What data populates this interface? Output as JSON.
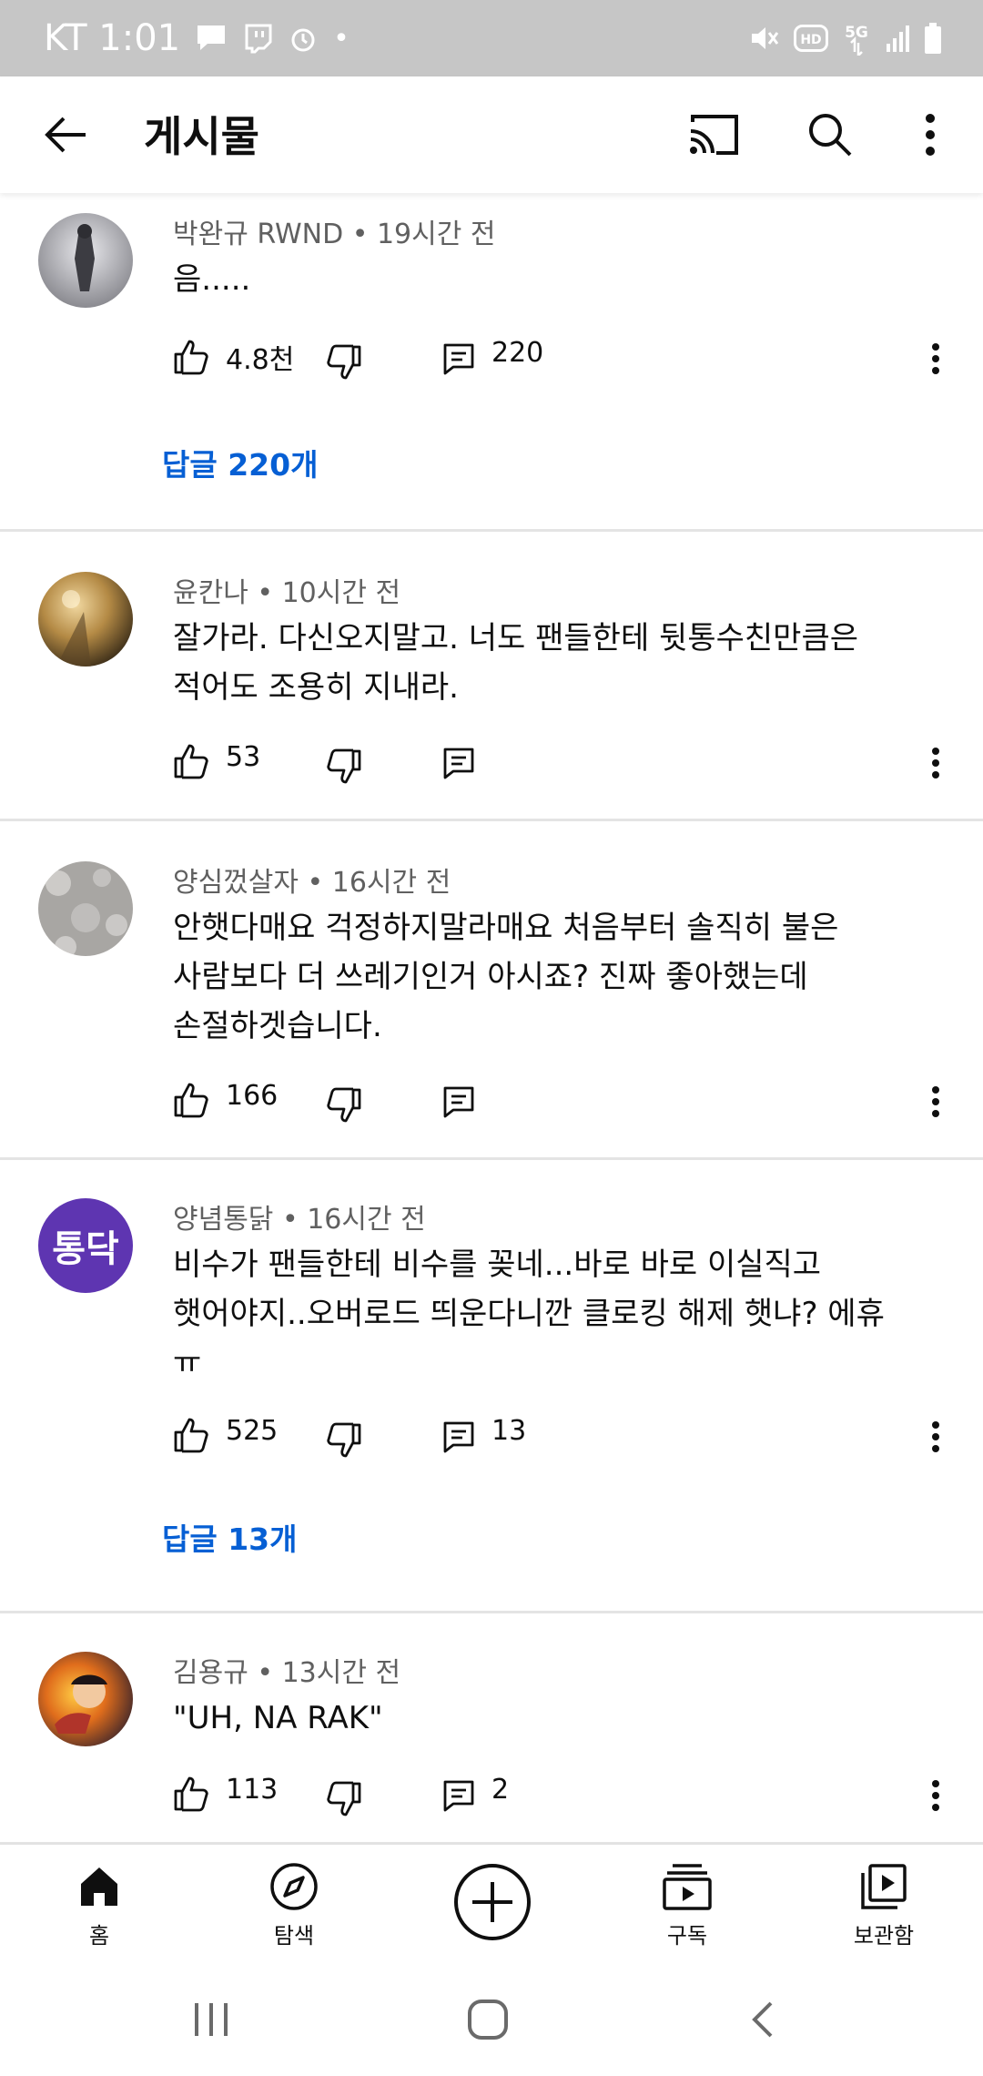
{
  "status_bar": {
    "carrier_time": "KT 1:01",
    "dot": "•",
    "icons": [
      "message-icon",
      "twitch-icon",
      "alarm-icon",
      "mute-icon",
      "hd-icon",
      "5g-icon",
      "signal-icon",
      "battery-icon"
    ]
  },
  "app_bar": {
    "title": "게시물",
    "icons": [
      "back-arrow-icon",
      "cast-icon",
      "search-icon",
      "more-vert-icon"
    ]
  },
  "comments": [
    {
      "author": "박완규 RWND",
      "time": "19시간 전",
      "text_lines": [
        "음....."
      ],
      "likes": "4.8천",
      "replies": "220",
      "replies_link": "답글 220개",
      "avatar": {
        "type": "photo",
        "colors": [
          "#d8d8dc",
          "#55555a"
        ]
      }
    },
    {
      "author": "윤칸나",
      "time": "10시간 전",
      "text_lines": [
        "잘가라. 다신오지말고. 너도 팬들한테 뒷통수친만큼은",
        "적어도 조용히 지내라."
      ],
      "likes": "53",
      "replies": "",
      "replies_link": "",
      "avatar": {
        "type": "photo",
        "colors": [
          "#c9a35d",
          "#4a3a20"
        ]
      }
    },
    {
      "author": "양심껐살자",
      "time": "16시간 전",
      "text_lines": [
        "안햇다매요 걱정하지말라매요 처음부터 솔직히 불은",
        "사람보다 더 쓰레기인거 아시죠? 진짜 좋아했는데",
        "손절하겟습니다."
      ],
      "likes": "166",
      "replies": "",
      "replies_link": "",
      "avatar": {
        "type": "photo",
        "colors": [
          "#b8b6b3",
          "#8e8c89"
        ]
      }
    },
    {
      "author": "양념통닭",
      "time": "16시간 전",
      "text_lines": [
        "비수가 팬들한테 비수를 꽂네...바로 바로 이실직고",
        "햇어야지..오버로드 띄운다니깐 클로킹 해제 햇냐? 에휴",
        "ㅠ"
      ],
      "likes": "525",
      "replies": "13",
      "replies_link": "답글 13개",
      "avatar": {
        "type": "initials",
        "initials": "통닥",
        "colors": [
          "#5e35b1",
          "#ffffff"
        ]
      }
    },
    {
      "author": "김용규",
      "time": "13시간 전",
      "text_lines": [
        "\"UH, NA RAK\""
      ],
      "likes": "113",
      "replies": "2",
      "replies_link": "",
      "avatar": {
        "type": "photo",
        "colors": [
          "#e06d1c",
          "#2a1d2c"
        ]
      }
    }
  ],
  "bottom_nav": {
    "items": [
      {
        "label": "홈",
        "icon": "home-icon"
      },
      {
        "label": "탐색",
        "icon": "explore-icon"
      },
      {
        "label": "",
        "icon": "create-icon"
      },
      {
        "label": "구독",
        "icon": "subscriptions-icon"
      },
      {
        "label": "보관함",
        "icon": "library-icon"
      }
    ]
  },
  "system_nav": {
    "icons": [
      "recents-icon",
      "home-circle-icon",
      "back-icon"
    ]
  },
  "colors": {
    "link_blue": "#065fd4",
    "meta_gray": "#606060",
    "status_bar_bg": "#c6c6c6",
    "initials_avatar_bg": "#5e35b1"
  }
}
